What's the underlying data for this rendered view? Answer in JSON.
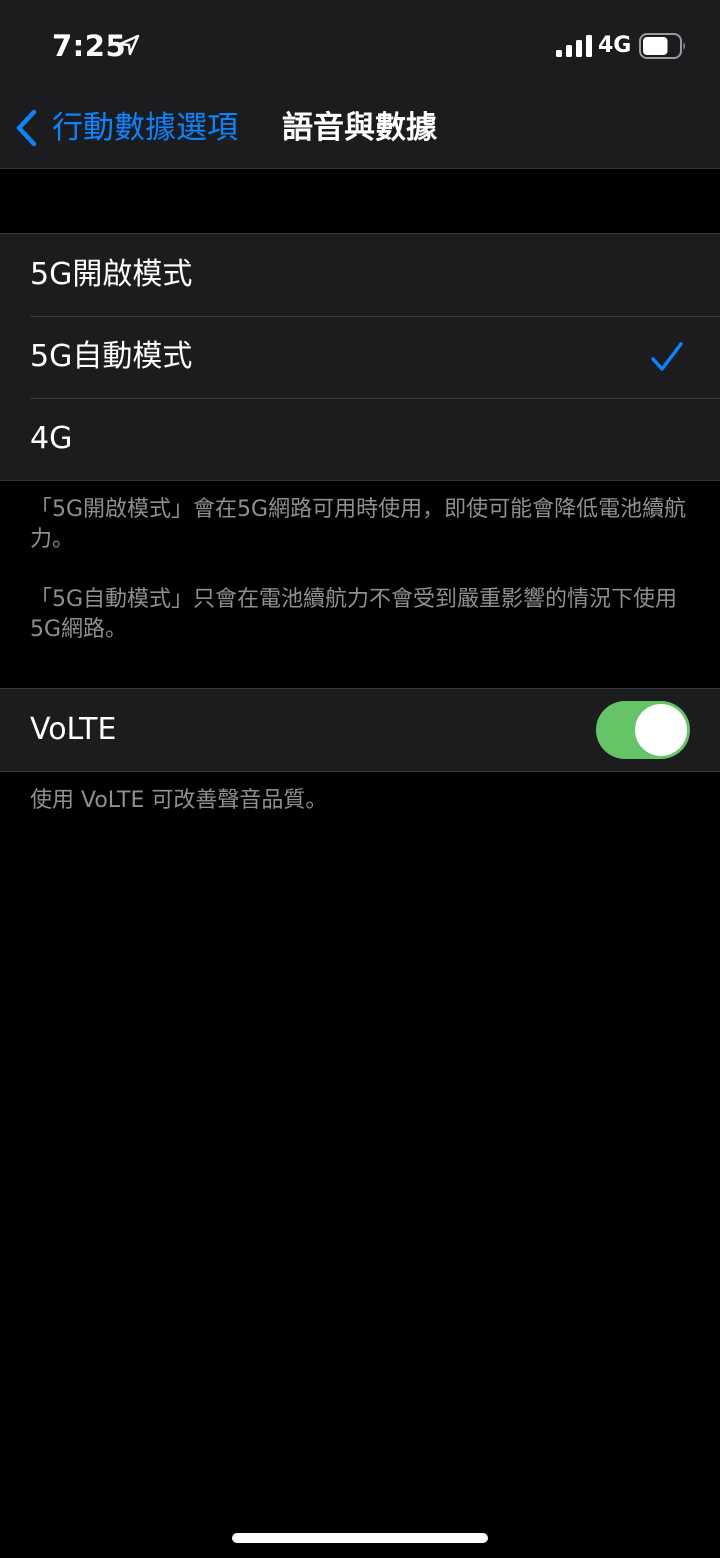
{
  "status_bar": {
    "time": "7:25",
    "network": "4G",
    "icons": [
      "location-arrow-icon",
      "signal-bars-icon",
      "battery-icon"
    ],
    "battery_level": 0.7
  },
  "nav": {
    "back_label": "行動數據選項",
    "title": "語音與數據",
    "back_icon": "chevron-left-icon"
  },
  "options": [
    {
      "label": "5G開啟模式",
      "selected": false
    },
    {
      "label": "5G自動模式",
      "selected": true
    },
    {
      "label": "4G",
      "selected": false
    }
  ],
  "options_footer": {
    "p1": "「5G開啟模式」會在5G網路可用時使用，即使可能會降低電池續航力。",
    "p2": "「5G自動模式」只會在電池續航力不會受到嚴重影響的情況下使用5G網路。"
  },
  "volte": {
    "label": "VoLTE",
    "enabled": true,
    "footer": "使用 VoLTE 可改善聲音品質。"
  },
  "colors": {
    "accent": "#0a84ff",
    "toggle_on": "#65c466",
    "background": "#000000",
    "cell_background": "#1c1c1e",
    "secondary_text": "#8e8e93"
  }
}
